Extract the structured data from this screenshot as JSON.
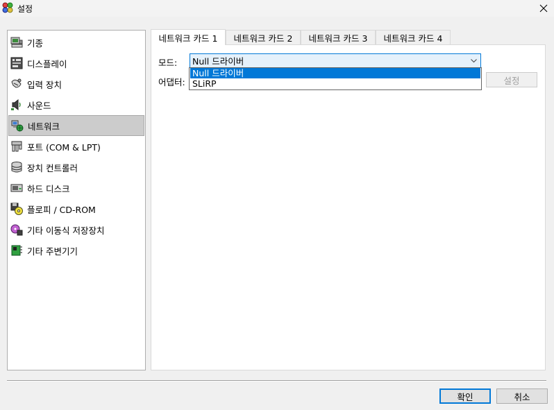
{
  "window": {
    "title": "설정",
    "close_icon": "close-icon"
  },
  "sidebar": {
    "items": [
      {
        "label": "기종",
        "icon": "machine-icon"
      },
      {
        "label": "디스플레이",
        "icon": "display-icon"
      },
      {
        "label": "입력 장치",
        "icon": "input-devices-icon"
      },
      {
        "label": "사운드",
        "icon": "sound-icon"
      },
      {
        "label": "네트워크",
        "icon": "network-icon",
        "selected": true
      },
      {
        "label": "포트 (COM & LPT)",
        "icon": "ports-icon"
      },
      {
        "label": "장치 컨트롤러",
        "icon": "storage-controllers-icon"
      },
      {
        "label": "하드 디스크",
        "icon": "hard-disk-icon"
      },
      {
        "label": "플로피 / CD-ROM",
        "icon": "floppy-cdrom-icon"
      },
      {
        "label": "기타 이동식 저장장치",
        "icon": "removable-storage-icon"
      },
      {
        "label": "기타 주변기기",
        "icon": "peripherals-icon"
      }
    ]
  },
  "tabs": [
    {
      "label": "네트워크 카드 1",
      "active": true
    },
    {
      "label": "네트워크 카드 2"
    },
    {
      "label": "네트워크 카드 3"
    },
    {
      "label": "네트워크 카드 4"
    }
  ],
  "network": {
    "mode_label": "모드:",
    "mode_value": "Null 드라이버",
    "mode_options": [
      "Null 드라이버",
      "SLiRP"
    ],
    "adapter_label": "어댑터:",
    "configure_button": "설정"
  },
  "footer": {
    "ok_button": "확인",
    "cancel_button": "취소"
  },
  "colors": {
    "accent": "#0078d7",
    "selected_bg": "#cccccc"
  }
}
